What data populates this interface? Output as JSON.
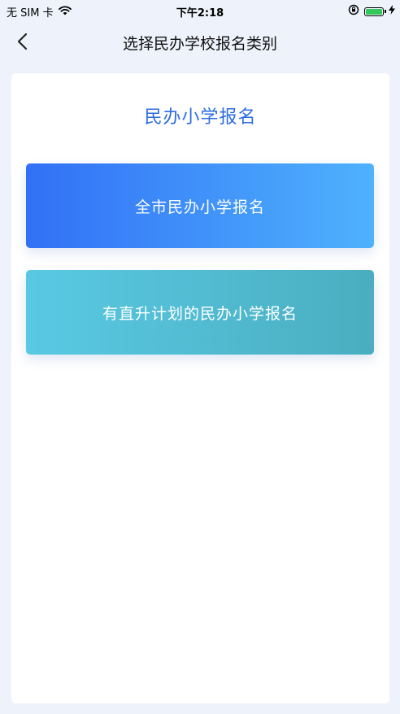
{
  "status_bar": {
    "carrier": "无 SIM 卡",
    "time": "下午2:18",
    "icons": [
      "wifi-icon",
      "orientation-lock-icon",
      "battery-icon",
      "charging-icon"
    ],
    "battery_color": "#34c759"
  },
  "nav": {
    "back_icon": "chevron-left-icon",
    "title": "选择民办学校报名类别"
  },
  "section": {
    "title": "民办小学报名",
    "accent_color": "#2d6cdf"
  },
  "options": [
    {
      "label": "全市民办小学报名"
    },
    {
      "label": "有直升计划的民办小学报名"
    }
  ]
}
